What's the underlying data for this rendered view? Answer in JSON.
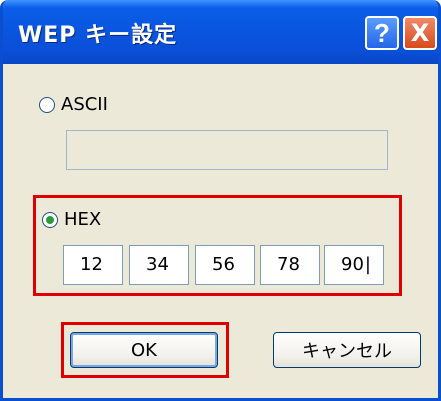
{
  "window": {
    "title": "WEP キー設定"
  },
  "titlebar": {
    "help_label": "?",
    "close_label": "X"
  },
  "options": {
    "ascii": {
      "label": "ASCII",
      "selected": false,
      "value": ""
    },
    "hex": {
      "label": "HEX",
      "selected": true,
      "values": [
        "12",
        "34",
        "56",
        "78",
        "90"
      ]
    }
  },
  "buttons": {
    "ok_label": "OK",
    "cancel_label": "キャンセル"
  },
  "colors": {
    "title_bar": "#0a55df",
    "highlight": "#e00000",
    "dialog_bg": "#ece9d8"
  }
}
